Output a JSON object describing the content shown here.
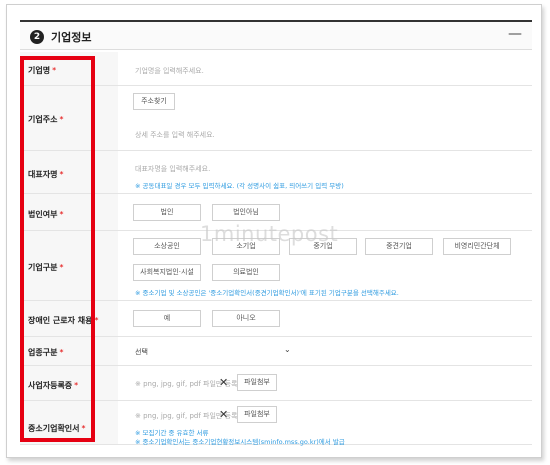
{
  "section": {
    "number": "2",
    "title": "기업정보",
    "collapse_symbol": "—"
  },
  "fields": {
    "company_name": {
      "label": "기업명",
      "required_mark": "*",
      "placeholder": "기업명을 입력해주세요."
    },
    "company_address": {
      "label": "기업주소",
      "required_mark": "*",
      "search_button": "주소찾기",
      "detail_placeholder": "상세 주소를 입력 해주세요."
    },
    "ceo_name": {
      "label": "대표자명",
      "required_mark": "*",
      "placeholder": "대표자명을 입력해주세요.",
      "note": "※ 공동대표일 경우 모두 입력하세요. (각 성명사이 쉼표, 띄어쓰기 입력 무방)"
    },
    "corporate_status": {
      "label": "법인여부",
      "required_mark": "*",
      "options": [
        "법인",
        "법인아님"
      ]
    },
    "company_type": {
      "label": "기업구분",
      "required_mark": "*",
      "options_row1": [
        "소상공인",
        "소기업",
        "중기업",
        "중견기업",
        "비영리민간단체"
      ],
      "options_row2": [
        "사회복지법인·시설",
        "의료법인"
      ],
      "note": "※ 중소기업 및 소상공인은 '중소기업확인서(중견기업확인서)'에 표기된 기업구분을 선택해주세요."
    },
    "disabled_hiring": {
      "label": "장애인 근로자 채용",
      "required_mark": "*",
      "options": [
        "예",
        "아니오"
      ]
    },
    "industry": {
      "label": "업종구분",
      "required_mark": "*",
      "selected": "선택"
    },
    "business_registration": {
      "label": "사업자등록증",
      "required_mark": "*",
      "file_hint": "※ png, jpg, gif, pdf 파일만 등록 가능",
      "attach_button": "파일첨부"
    },
    "sme_certificate": {
      "label": "중소기업확인서",
      "required_mark": "*",
      "file_hint": "※ png, jpg, gif, pdf 파일만 등록 가능",
      "attach_button": "파일첨부",
      "note1": "※ 모집기간 중 유효한 서류",
      "note2": "※ 중소기업확인서는 중소기업현황정보시스템(sminfo.mss.go.kr)에서 발급"
    }
  },
  "watermark": "1minutepost",
  "colors": {
    "required": "#e30000",
    "note": "#2e9be0",
    "highlight_box": "#e60012"
  }
}
